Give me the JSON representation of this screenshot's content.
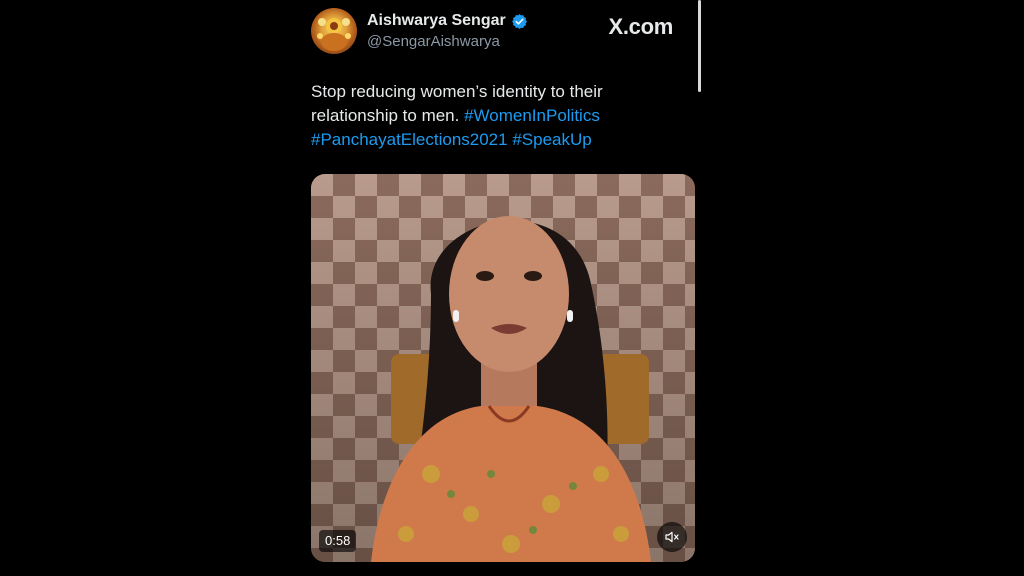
{
  "author": {
    "display_name": "Aishwarya Sengar",
    "handle": "@SengarAishwarya",
    "verified": true
  },
  "branding": {
    "logo_text": "X.com"
  },
  "tweet": {
    "text_parts": [
      {
        "text": "Stop reducing women’s identity to their relationship to men. ",
        "kind": "plain"
      },
      {
        "text": "#WomenInPolitics",
        "kind": "hashtag"
      },
      {
        "text": " ",
        "kind": "plain"
      },
      {
        "text": "#PanchayatElections2021",
        "kind": "hashtag"
      },
      {
        "text": " ",
        "kind": "plain"
      },
      {
        "text": "#SpeakUp",
        "kind": "hashtag"
      }
    ]
  },
  "video": {
    "duration": "0:58",
    "muted": true
  },
  "colors": {
    "background": "#000000",
    "text": "#e7e9ea",
    "secondary_text": "#8b98a5",
    "link": "#1d9bf0",
    "verified_badge": "#1d9bf0"
  },
  "icons": {
    "verified": "verified-badge-icon",
    "mute": "speaker-muted-icon"
  }
}
